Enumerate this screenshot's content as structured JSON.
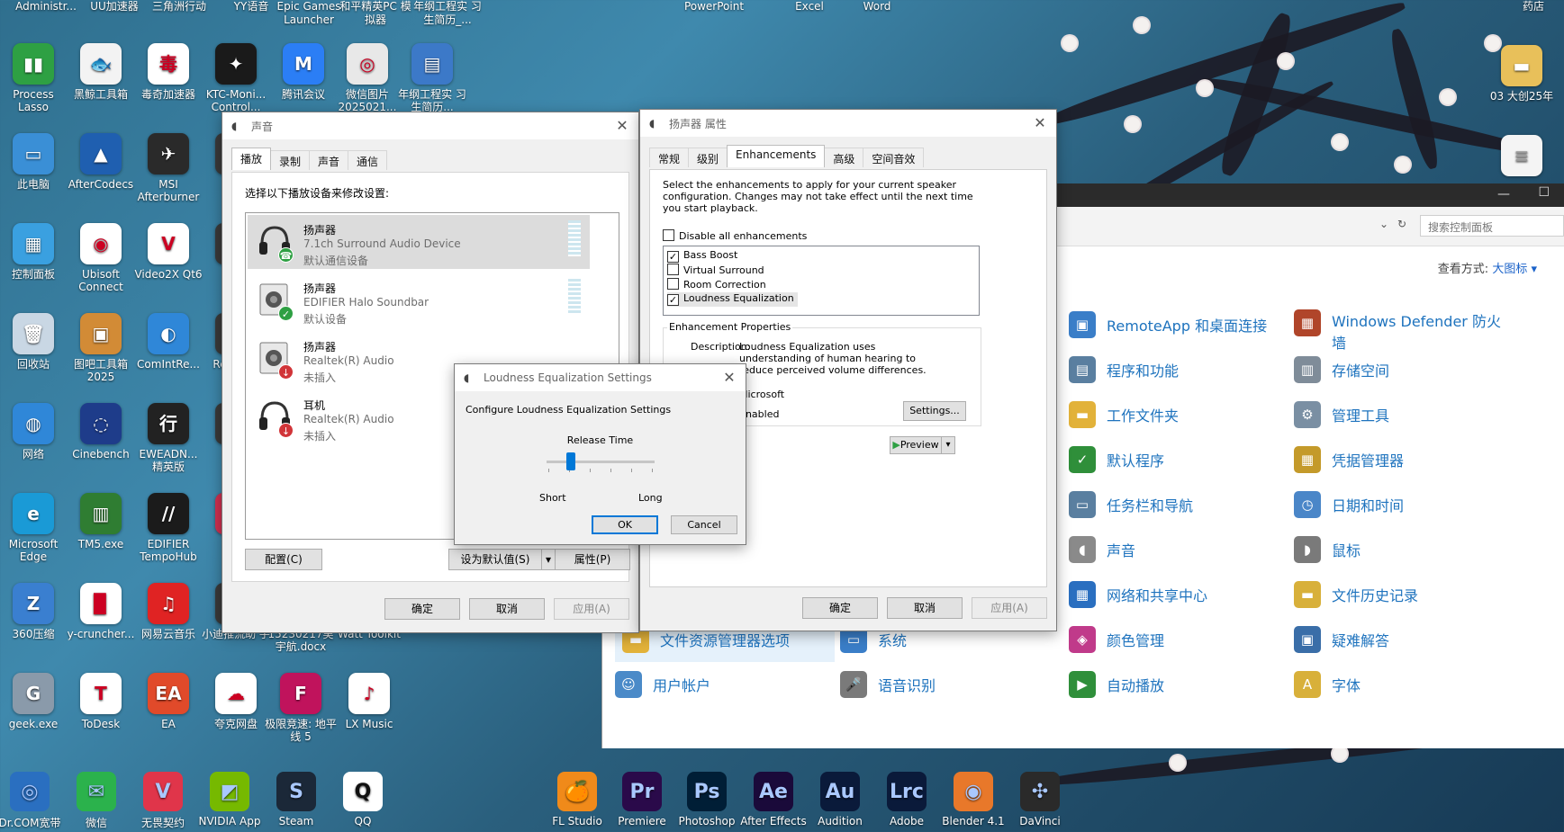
{
  "desktop_top_row": [
    "Administr...",
    "UU加速器",
    "三角洲行动",
    "YY语音",
    "Epic Games Launcher",
    "和平精英PC 模拟器",
    "年纲工程实 习生简历_...",
    "PowerPoint",
    "Excel",
    "Word",
    "药店"
  ],
  "desktop_icons": [
    {
      "label": "Process Lasso",
      "color": "#2ea043",
      "glyph": "▮▮"
    },
    {
      "label": "黑鲸工具箱",
      "color": "#f3f3f3",
      "glyph": "🐟"
    },
    {
      "label": "毒奇加速器",
      "color": "#ffffff",
      "glyph": "毒"
    },
    {
      "label": "KTC-Moni... Control...",
      "color": "#1a1a1a",
      "glyph": "✦"
    },
    {
      "label": "腾讯会议",
      "color": "#2b7ef5",
      "glyph": "M"
    },
    {
      "label": "微信图片 2025021...",
      "color": "#e8e8e8",
      "glyph": "◎"
    },
    {
      "label": "年纲工程实 习生简历...",
      "color": "#3c79c8",
      "glyph": "▤"
    },
    {
      "label": "此电脑",
      "color": "#3a8fd6",
      "glyph": "▭"
    },
    {
      "label": "AfterCodecs",
      "color": "#1f5fb0",
      "glyph": "▲"
    },
    {
      "label": "MSI Afterburner",
      "color": "#2a2a2a",
      "glyph": "✈"
    },
    {
      "label": "Lo...",
      "color": "#3a3a3a",
      "glyph": "L"
    },
    {
      "label": "控制面板",
      "color": "#3aa0e0",
      "glyph": "▦"
    },
    {
      "label": "Ubisoft Connect",
      "color": "#ffffff",
      "glyph": "◉"
    },
    {
      "label": "Video2X Qt6",
      "color": "#ffffff",
      "glyph": "V"
    },
    {
      "label": "百...",
      "color": "#3a3a3a",
      "glyph": "百"
    },
    {
      "label": "回收站",
      "color": "#c9d7e4",
      "glyph": "🗑"
    },
    {
      "label": "图吧工具箱 2025",
      "color": "#d28b36",
      "glyph": "▣"
    },
    {
      "label": "ComIntRe...",
      "color": "#2f87d8",
      "glyph": "◐"
    },
    {
      "label": "Re... G...",
      "color": "#3a3a3a",
      "glyph": "R"
    },
    {
      "label": "网络",
      "color": "#2f87d8",
      "glyph": "◍"
    },
    {
      "label": "Cinebench",
      "color": "#1e3c8a",
      "glyph": "◌"
    },
    {
      "label": "EWEADN... 精英版",
      "color": "#222222",
      "glyph": "行"
    },
    {
      "label": "OB...",
      "color": "#3a3a3a",
      "glyph": "O"
    },
    {
      "label": "Microsoft Edge",
      "color": "#1a9ad6",
      "glyph": "e"
    },
    {
      "label": "TM5.exe",
      "color": "#2f7d32",
      "glyph": "▥"
    },
    {
      "label": "EDIFIER TempoHub",
      "color": "#1b1b1b",
      "glyph": "//"
    },
    {
      "label": "直...",
      "color": "#d03050",
      "glyph": "直"
    },
    {
      "label": "360压缩",
      "color": "#3a7fd0",
      "glyph": "Z"
    },
    {
      "label": "y-cruncher...",
      "color": "#ffffff",
      "glyph": "▉"
    },
    {
      "label": "网易云音乐",
      "color": "#e02323",
      "glyph": "♫"
    },
    {
      "label": "小迪推流助 手",
      "color": "#3a3a3a",
      "glyph": "小"
    },
    {
      "label": "15230217吴 宇航.docx",
      "color": "#2b5797",
      "glyph": "W"
    },
    {
      "label": "Watt Toolkit",
      "color": "#3a3a3a",
      "glyph": "⚙"
    },
    {
      "label": "geek.exe",
      "color": "#8a9aaa",
      "glyph": "G"
    },
    {
      "label": "ToDesk",
      "color": "#ffffff",
      "glyph": "T"
    },
    {
      "label": "EA",
      "color": "#e14a2a",
      "glyph": "EA"
    },
    {
      "label": "夸克网盘",
      "color": "#ffffff",
      "glyph": "☁"
    },
    {
      "label": "极限竞速: 地平线 5",
      "color": "#c0135c",
      "glyph": "F"
    },
    {
      "label": "LX Music",
      "color": "#ffffff",
      "glyph": "♪"
    }
  ],
  "dock": [
    {
      "label": "Dr.COM宽带",
      "color": "#2a6fc0",
      "glyph": "◎"
    },
    {
      "label": "微信",
      "color": "#2bb24c",
      "glyph": "✉"
    },
    {
      "label": "无畏契约",
      "color": "#e0354a",
      "glyph": "V"
    },
    {
      "label": "NVIDIA App",
      "color": "#76b900",
      "glyph": "◩"
    },
    {
      "label": "Steam",
      "color": "#1b2838",
      "glyph": "S"
    },
    {
      "label": "QQ",
      "color": "#ffffff",
      "glyph": "Q"
    },
    {
      "label": "FL Studio",
      "color": "#f08a1a",
      "glyph": "🍊"
    },
    {
      "label": "Premiere",
      "color": "#2a0a4a",
      "glyph": "Pr"
    },
    {
      "label": "Photoshop",
      "color": "#001e36",
      "glyph": "Ps"
    },
    {
      "label": "After Effects",
      "color": "#1a0a3a",
      "glyph": "Ae"
    },
    {
      "label": "Audition",
      "color": "#0a1a3a",
      "glyph": "Au"
    },
    {
      "label": "Adobe",
      "color": "#0a1a3a",
      "glyph": "Lrc"
    },
    {
      "label": "Blender 4.1",
      "color": "#e8782a",
      "glyph": "◉"
    },
    {
      "label": "DaVinci",
      "color": "#2a2a2a",
      "glyph": "✣"
    }
  ],
  "desktop_right": {
    "label": "03 大创25年",
    "doc_label": ""
  },
  "control_panel": {
    "search_placeholder": "搜索控制面板",
    "view_by_label": "查看方式:",
    "view_by_value": "大图标 ▾",
    "items": [
      {
        "label": "RemoteApp 和桌面连接",
        "color": "#3a7ec8",
        "glyph": "▣"
      },
      {
        "label": "Windows Defender 防火墙",
        "color": "#b0452a",
        "glyph": "▦"
      },
      {
        "label": "程序和功能",
        "color": "#5a7fa0",
        "glyph": "▤"
      },
      {
        "label": "存储空间",
        "color": "#7f8c99",
        "glyph": "▥"
      },
      {
        "label": "工作文件夹",
        "color": "#e2b23a",
        "glyph": "▬"
      },
      {
        "label": "管理工具",
        "color": "#7a8fa3",
        "glyph": "⚙"
      },
      {
        "label": "默认程序",
        "color": "#2f8f3a",
        "glyph": "✓"
      },
      {
        "label": "凭据管理器",
        "color": "#c49a2a",
        "glyph": "▦"
      },
      {
        "label": "任务栏和导航",
        "color": "#5a7fa0",
        "glyph": "▭"
      },
      {
        "label": "日期和时间",
        "color": "#4a86c8",
        "glyph": "◷"
      },
      {
        "label": "声音",
        "color": "#8a8a8a",
        "glyph": "◖"
      },
      {
        "label": "鼠标",
        "color": "#7a7a7a",
        "glyph": "◗"
      },
      {
        "label": "网络和共享中心",
        "color": "#2a6fc0",
        "glyph": "▦"
      },
      {
        "label": "文件历史记录",
        "color": "#d8b03a",
        "glyph": "▬"
      },
      {
        "label": "文件资源管理器选项",
        "color": "#e2b23a",
        "glyph": "▬"
      },
      {
        "label": "系统",
        "color": "#3a7ec8",
        "glyph": "▭"
      },
      {
        "label": "颜色管理",
        "color": "#c03a8a",
        "glyph": "◈"
      },
      {
        "label": "疑难解答",
        "color": "#3a6ea8",
        "glyph": "▣"
      },
      {
        "label": "用户帐户",
        "color": "#4a8ac8",
        "glyph": "☺"
      },
      {
        "label": "语音识别",
        "color": "#7a7a7a",
        "glyph": "🎤"
      },
      {
        "label": "自动播放",
        "color": "#2f8f3a",
        "glyph": "▶"
      },
      {
        "label": "字体",
        "color": "#d8b03a",
        "glyph": "A"
      }
    ]
  },
  "sound_dialog": {
    "title": "声音",
    "tabs": [
      "播放",
      "录制",
      "声音",
      "通信"
    ],
    "instruction": "选择以下播放设备来修改设置:",
    "devices": [
      {
        "name": "扬声器",
        "sub": "7.1ch Surround Audio Device",
        "status": "默认通信设备",
        "badge": "phone",
        "badge_color": "#2ea043"
      },
      {
        "name": "扬声器",
        "sub": "EDIFIER Halo Soundbar",
        "status": "默认设备",
        "badge": "✓",
        "badge_color": "#2ea043"
      },
      {
        "name": "扬声器",
        "sub": "Realtek(R) Audio",
        "status": "未插入",
        "badge": "↓",
        "badge_color": "#d13438"
      },
      {
        "name": "耳机",
        "sub": "Realtek(R) Audio",
        "status": "未插入",
        "badge": "↓",
        "badge_color": "#d13438"
      }
    ],
    "configure_label": "配置(C)",
    "set_default_label": "设为默认值(S)",
    "properties_label": "属性(P)",
    "ok_label": "确定",
    "cancel_label": "取消",
    "apply_label": "应用(A)"
  },
  "speaker_props": {
    "title": "扬声器 属性",
    "tabs": [
      "常规",
      "级别",
      "Enhancements",
      "高级",
      "空间音效"
    ],
    "intro": "Select the enhancements to apply for your current speaker configuration. Changes may not take effect until the next time you start playback.",
    "disable_all_label": "Disable all enhancements",
    "disable_all_checked": false,
    "enhancements": [
      {
        "label": "Bass Boost",
        "checked": true
      },
      {
        "label": "Virtual Surround",
        "checked": false
      },
      {
        "label": "Room Correction",
        "checked": false
      },
      {
        "label": "Loudness Equalization",
        "checked": true
      }
    ],
    "props_group_label": "Enhancement Properties",
    "description_label": "Description:",
    "description": "Loudness Equalization uses understanding of human hearing to reduce perceived volume differences.",
    "provider": "Microsoft",
    "status": "Enabled",
    "settings_label": "Settings...",
    "preview_label": "Preview",
    "ok_label": "确定",
    "cancel_label": "取消",
    "apply_label": "应用(A)"
  },
  "loudness_dialog": {
    "title": "Loudness Equalization Settings",
    "heading": "Configure Loudness Equalization Settings",
    "slider_label": "Release Time",
    "slider_min_label": "Short",
    "slider_max_label": "Long",
    "slider_value": 0.2,
    "ok_label": "OK",
    "cancel_label": "Cancel"
  }
}
